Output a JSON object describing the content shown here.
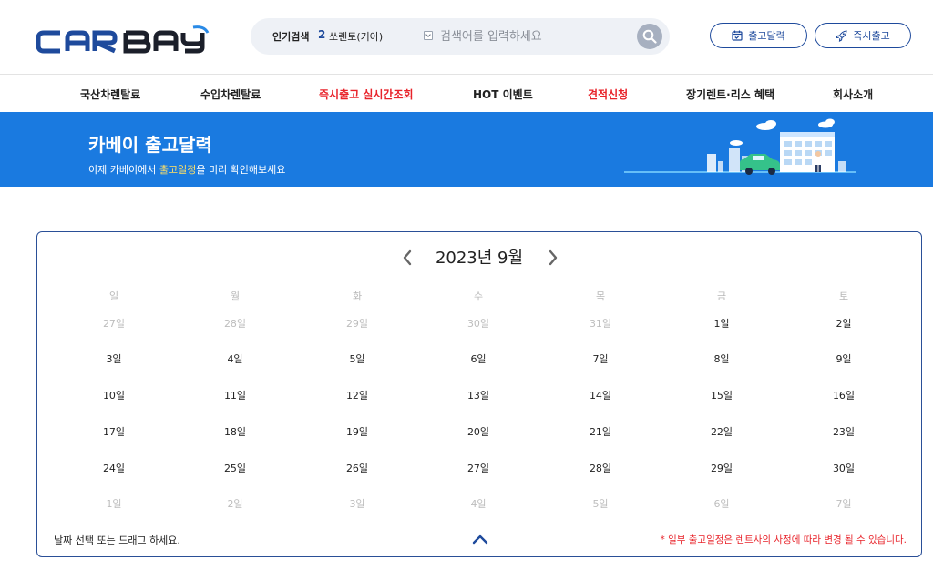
{
  "header": {
    "logo_text": "CARBAY",
    "search": {
      "popular_label": "인기검색",
      "popular_rank": "2",
      "popular_term": "쏘렌토(기아)",
      "placeholder": "검색어를 입력하세요"
    },
    "buttons": {
      "calendar_label": "출고달력",
      "instant_label": "즉시출고"
    }
  },
  "nav": {
    "items": [
      {
        "label": "국산차렌탈료"
      },
      {
        "label": "수입차렌탈료"
      },
      {
        "label": "즉시출고 실시간조회"
      },
      {
        "label": "HOT 이벤트"
      },
      {
        "label": "견적신청"
      },
      {
        "label": "장기렌트·리스 혜택"
      },
      {
        "label": "회사소개"
      }
    ],
    "accent_red": "#e8232a"
  },
  "banner": {
    "title": "카베이 출고달력",
    "subtitle_pre": "이제 카베이에서 ",
    "subtitle_highlight": "출고일정",
    "subtitle_post": "을 미리 확인해보세요",
    "bg_color": "#1a7ae0"
  },
  "calendar": {
    "title": "2023년 9월",
    "weekdays": [
      "일",
      "월",
      "화",
      "수",
      "목",
      "금",
      "토"
    ],
    "weeks": [
      [
        {
          "t": "27일",
          "m": true
        },
        {
          "t": "28일",
          "m": true
        },
        {
          "t": "29일",
          "m": true
        },
        {
          "t": "30일",
          "m": true
        },
        {
          "t": "31일",
          "m": true
        },
        {
          "t": "1일",
          "m": false
        },
        {
          "t": "2일",
          "m": false
        }
      ],
      [
        {
          "t": "3일",
          "m": false
        },
        {
          "t": "4일",
          "m": false
        },
        {
          "t": "5일",
          "m": false
        },
        {
          "t": "6일",
          "m": false
        },
        {
          "t": "7일",
          "m": false
        },
        {
          "t": "8일",
          "m": false
        },
        {
          "t": "9일",
          "m": false
        }
      ],
      [
        {
          "t": "10일",
          "m": false
        },
        {
          "t": "11일",
          "m": false
        },
        {
          "t": "12일",
          "m": false
        },
        {
          "t": "13일",
          "m": false
        },
        {
          "t": "14일",
          "m": false
        },
        {
          "t": "15일",
          "m": false
        },
        {
          "t": "16일",
          "m": false
        }
      ],
      [
        {
          "t": "17일",
          "m": false
        },
        {
          "t": "18일",
          "m": false
        },
        {
          "t": "19일",
          "m": false
        },
        {
          "t": "20일",
          "m": false
        },
        {
          "t": "21일",
          "m": false
        },
        {
          "t": "22일",
          "m": false
        },
        {
          "t": "23일",
          "m": false
        }
      ],
      [
        {
          "t": "24일",
          "m": false
        },
        {
          "t": "25일",
          "m": false
        },
        {
          "t": "26일",
          "m": false
        },
        {
          "t": "27일",
          "m": false
        },
        {
          "t": "28일",
          "m": false
        },
        {
          "t": "29일",
          "m": false
        },
        {
          "t": "30일",
          "m": false
        }
      ],
      [
        {
          "t": "1일",
          "m": true
        },
        {
          "t": "2일",
          "m": true
        },
        {
          "t": "3일",
          "m": true
        },
        {
          "t": "4일",
          "m": true
        },
        {
          "t": "5일",
          "m": true
        },
        {
          "t": "6일",
          "m": true
        },
        {
          "t": "7일",
          "m": true
        }
      ]
    ],
    "hint": "날짜 선택 또는 드래그 하세요.",
    "note": "* 일부 출고일정은 렌트사의 사정에 따라 변경 될 수 있습니다.",
    "border_color": "#2a4f97"
  }
}
